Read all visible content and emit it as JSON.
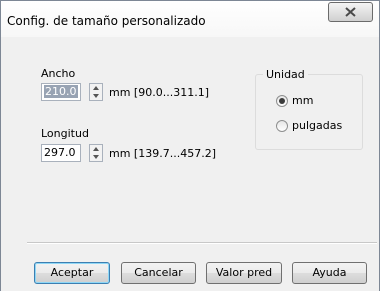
{
  "window": {
    "title": "Config. de tamaño personalizado",
    "close_label": "X"
  },
  "width": {
    "label": "Ancho",
    "value": "210.0",
    "range": "mm [90.0...311.1]"
  },
  "length": {
    "label": "Longitud",
    "value": "297.0",
    "range": "mm [139.7...457.2]"
  },
  "unit": {
    "group_title": "Unidad",
    "options": [
      {
        "label": "mm",
        "selected": true
      },
      {
        "label": "pulgadas",
        "selected": false
      }
    ]
  },
  "buttons": {
    "accept": "Aceptar",
    "cancel": "Cancelar",
    "default": "Valor pred",
    "help": "Ayuda"
  }
}
